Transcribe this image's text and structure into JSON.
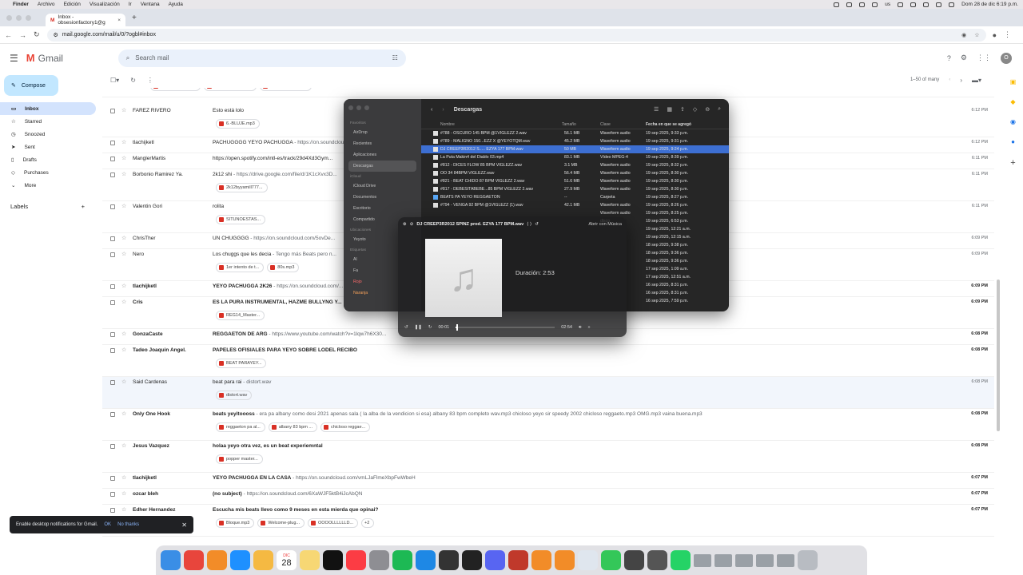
{
  "menubar": {
    "apple": "",
    "items": [
      "Finder",
      "Archivo",
      "Edición",
      "Visualización",
      "Ir",
      "Ventana",
      "Ayuda"
    ],
    "status": [
      "us"
    ],
    "clock": "Dom 28 de dic  6:19 p.m."
  },
  "browser": {
    "tab_title": "Inbox - obsesionfactory1@g",
    "url": "mail.google.com/mail/u/0/?ogbl#inbox"
  },
  "gmail": {
    "logo": "Gmail",
    "search_placeholder": "Search mail",
    "compose": "Compose",
    "nav": [
      {
        "icon": "inbox-icon",
        "label": "Inbox"
      },
      {
        "icon": "star-icon",
        "label": "Starred"
      },
      {
        "icon": "clock-icon",
        "label": "Snoozed"
      },
      {
        "icon": "send-icon",
        "label": "Sent"
      },
      {
        "icon": "file-icon",
        "label": "Drafts"
      },
      {
        "icon": "tag-icon",
        "label": "Purchases"
      },
      {
        "icon": "chevron-down-icon",
        "label": "More"
      }
    ],
    "labels_title": "Labels",
    "labels_add": "+",
    "pagination": "1–50 of many",
    "avatar": "O",
    "toast": {
      "text": "Enable desktop notifications for Gmail.",
      "ok": "OK",
      "no": "No thanks",
      "close": "✕"
    },
    "rows": [
      {
        "sender": "",
        "subject": "",
        "snippet": "",
        "date": "",
        "bold": false,
        "hl": false,
        "chips": [
          "BEAT SENSACI...",
          "BEAT TUKI S TO...",
          "BEAT FERRAGA..."
        ]
      },
      {
        "sender": "FAREZ RIVERO",
        "subject": "Esto está lolo",
        "snippet": "",
        "date": "6:12 PM",
        "bold": false,
        "hl": false,
        "chips": [
          "6.-BLUJE.mp3"
        ]
      },
      {
        "sender": "tlachijketl",
        "subject": "PACHUGGGG YEYO PACHUGGA",
        "snippet": " - https://on.soundcloud.com/...",
        "date": "6:12 PM",
        "bold": false,
        "hl": false,
        "chips": []
      },
      {
        "sender": "ManglerMartis",
        "subject": "https://open.spotify.com/intl-es/track/29d4Xd3Gym...",
        "snippet": "",
        "date": "6:11 PM",
        "bold": false,
        "hl": false,
        "chips": []
      },
      {
        "sender": "Borbonio Ramirez Ya.",
        "subject": "2k12 shi",
        "snippet": " - https://drive.google.com/file/d/1K1cXvx3D...",
        "date": "6:11 PM",
        "bold": false,
        "hl": false,
        "chips": [
          "2k12byyamill777..."
        ]
      },
      {
        "sender": "Valentin Gori",
        "subject": "rolita",
        "snippet": "",
        "date": "6:11 PM",
        "bold": false,
        "hl": false,
        "chips": [
          "SITUNOESTAS..."
        ]
      },
      {
        "sender": "ChrisTher",
        "subject": "UN CHUGGGG",
        "snippet": " - https://on.soundcloud.com/5ovDe...",
        "date": "6:09 PM",
        "bold": false,
        "hl": false,
        "chips": []
      },
      {
        "sender": "Nero",
        "subject": "Los chuggs que les decia",
        "snippet": " - Tengo más Beats pero n...",
        "date": "6:09 PM",
        "bold": false,
        "hl": false,
        "chips": [
          "1er intento de t...",
          "80s.mp3"
        ]
      },
      {
        "sender": "tlachijketl",
        "subject": "YEYO PACHUGGA 2K26",
        "snippet": " - https://on.soundcloud.com/...",
        "date": "6:09 PM",
        "bold": true,
        "hl": false,
        "chips": []
      },
      {
        "sender": "Cris",
        "subject": "ES LA PURA INSTRUMENTAL, HAZME BULLYNG Y...",
        "snippet": "",
        "date": "6:09 PM",
        "bold": true,
        "hl": false,
        "chips": [
          "REG14_Master..."
        ]
      },
      {
        "sender": "GonzaCaste",
        "subject": "REGGAETON DE ARG",
        "snippet": " - https://www.youtube.com/watch?v=1lqw7h6X30...",
        "date": "6:08 PM",
        "bold": true,
        "hl": false,
        "chips": []
      },
      {
        "sender": "Tadeo Joaquin Angel.",
        "subject": "PAPELES OFISIALES PARA YEYO SOBRE LODEL RECIBO",
        "snippet": "",
        "date": "6:08 PM",
        "bold": true,
        "hl": false,
        "chips": [
          "BEAT PARAYEY..."
        ]
      },
      {
        "sender": "Said Cardenas",
        "subject": "beat para rai",
        "snippet": " - distort.wav",
        "date": "6:08 PM",
        "bold": false,
        "hl": true,
        "chips": [
          "distort.wav"
        ]
      },
      {
        "sender": "Only One Hook",
        "subject": "beats yeyitoooss",
        "snippet": " - era pa albany como desi 2021 apenas sala ( la alba de la vendicion si esa) albany 83 bpm completo wav.mp3 chicloso yeyo sir speedy 2002 chicloso reggaeto.mp3 OMG.mp3 vaina buena.mp3",
        "date": "6:08 PM",
        "bold": true,
        "hl": false,
        "chips": [
          "reggaeton pa al...",
          "albany 83 bpm ...",
          "chicloso reggae..."
        ]
      },
      {
        "sender": "Jesus Vazquez",
        "subject": "holaa yeyo otra vez, es un beat experiemntal",
        "snippet": "",
        "date": "6:08 PM",
        "bold": true,
        "hl": false,
        "chips": [
          "popper master..."
        ]
      },
      {
        "sender": "tlachijketl",
        "subject": "YEYO PACHUGGA EN LA CASA",
        "snippet": " - https://on.soundcloud.com/vmLJaFlmeXbpFwWbeH",
        "date": "6:07 PM",
        "bold": true,
        "hl": false,
        "chips": []
      },
      {
        "sender": "ozcar bleh",
        "subject": "(no subject)",
        "snippet": " - https://on.soundcloud.com/6XaWJF5ktB4iJcAbQN",
        "date": "6:07 PM",
        "bold": true,
        "hl": false,
        "chips": []
      },
      {
        "sender": "Edher Hernandez",
        "subject": "Escucha mis beats llevo como 9 meses en esta mierda que opinai?",
        "snippet": "",
        "date": "6:07 PM",
        "bold": true,
        "hl": false,
        "chips": [
          "Bloque.mp3",
          "Welcome-plug...",
          "OOOOLLLLLLD...",
          "+2"
        ]
      }
    ]
  },
  "finder": {
    "title": "Descargas",
    "sidebar": {
      "sections": [
        {
          "name": "Favoritos",
          "items": [
            "AirDrop",
            "Recientes",
            "Aplicaciones",
            "Descargas"
          ]
        },
        {
          "name": "iCloud",
          "items": [
            "iCloud Drive",
            "Documentos",
            "Escritorio",
            "Compartido"
          ]
        },
        {
          "name": "Ubicaciones",
          "items": [
            "Yeyoto"
          ]
        },
        {
          "name": "Etiquetas",
          "items": [
            "Al",
            "Fa",
            "Rojo",
            "Naranja"
          ]
        }
      ],
      "selected": "Descargas"
    },
    "columns": [
      "Nombre",
      "Tamaño",
      "Clase",
      "Fecha en que se agregó"
    ],
    "rows": [
      {
        "name": "#788 - OSCURO 145 BPM @1VIGLEZZ 2.wav",
        "size": "56.1 MB",
        "kind": "Waveform audio",
        "date": "19 sep 2025, 9:33 p.m.",
        "sel": false,
        "folder": false
      },
      {
        "name": "#789 - MALIGNO 150...EZZ X @YEYOTQM.wav",
        "size": "45.2 MB",
        "kind": "Waveform audio",
        "date": "19 sep 2025, 9:31 p.m.",
        "sel": false,
        "folder": false
      },
      {
        "name": "DJ CREEP3R2012 S..... EZYA 177 BPM.wav",
        "size": "50 MB",
        "kind": "Waveform audio",
        "date": "19 sep 2025, 9:24 p.m.",
        "sel": true,
        "folder": false
      },
      {
        "name": "La Puta Makin4 del Diablo 03.mp4",
        "size": "83.1 MB",
        "kind": "Vídeo MPEG-4",
        "date": "19 sep 2025, 8:39 p.m.",
        "sel": false,
        "folder": false
      },
      {
        "name": "#812 - DICES FLOW 85 BPM VIGLEZZ.wav",
        "size": "3.1 MB",
        "kind": "Waveform audio",
        "date": "19 sep 2025, 8:32 p.m.",
        "sel": false,
        "folder": false
      },
      {
        "name": "OO 34 84BPM VIGLEZZ.wav",
        "size": "56.4 MB",
        "kind": "Waveform audio",
        "date": "19 sep 2025, 8:30 p.m.",
        "sel": false,
        "folder": false
      },
      {
        "name": "#821 - BEAT CHIDO 87 BPM VIGLEZZ 2.wav",
        "size": "51.6 MB",
        "kind": "Waveform audio",
        "date": "19 sep 2025, 8:30 p.m.",
        "sel": false,
        "folder": false
      },
      {
        "name": "#817 - DEBESITABEBE...85 BPM VIGLEZZ 2.wav",
        "size": "27.9 MB",
        "kind": "Waveform audio",
        "date": "19 sep 2025, 8:30 p.m.",
        "sel": false,
        "folder": false
      },
      {
        "name": "BEATS PA YEYO REGGAETON",
        "size": "--",
        "kind": "Carpeta",
        "date": "19 sep 2025, 8:27 p.m.",
        "sel": false,
        "folder": true
      },
      {
        "name": "#794 - VENGA 92 BPM @1VIGLEZZ (1).wav",
        "size": "42.1 MB",
        "kind": "Waveform audio",
        "date": "19 sep 2025, 8:26 p.m.",
        "sel": false,
        "folder": false
      },
      {
        "name": "",
        "size": "",
        "kind": "Waveform audio",
        "date": "19 sep 2025, 8:25 p.m.",
        "sel": false,
        "folder": false
      },
      {
        "name": "",
        "size": "",
        "kind": "disco",
        "date": "19 sep 2025, 6:53 p.m.",
        "sel": false,
        "folder": false
      },
      {
        "name": "",
        "size": "",
        "kind": "",
        "date": "19 sep 2025, 12:21 a.m.",
        "sel": false,
        "folder": false
      },
      {
        "name": "",
        "size": "",
        "kind": "",
        "date": "19 sep 2025, 12:15 a.m.",
        "sel": false,
        "folder": false
      },
      {
        "name": "",
        "size": "",
        "kind": "",
        "date": "18 sep 2025, 9:38 p.m.",
        "sel": false,
        "folder": false
      },
      {
        "name": "",
        "size": "",
        "kind": "",
        "date": "18 sep 2025, 9:36 p.m.",
        "sel": false,
        "folder": false
      },
      {
        "name": "",
        "size": "",
        "kind": "",
        "date": "18 sep 2025, 9:36 p.m.",
        "sel": false,
        "folder": false
      },
      {
        "name": "",
        "size": "",
        "kind": "",
        "date": "17 sep 2025, 1:09 a.m.",
        "sel": false,
        "folder": false
      },
      {
        "name": "",
        "size": "",
        "kind": "",
        "date": "17 sep 2025, 12:51 a.m.",
        "sel": false,
        "folder": false
      },
      {
        "name": "",
        "size": "",
        "kind": "",
        "date": "16 sep 2025, 8:31 p.m.",
        "sel": false,
        "folder": false
      },
      {
        "name": "",
        "size": "",
        "kind": "",
        "date": "16 sep 2025, 8:31 p.m.",
        "sel": false,
        "folder": false
      },
      {
        "name": "",
        "size": "",
        "kind": "",
        "date": "16 sep 2025, 7:59 p.m.",
        "sel": false,
        "folder": false
      }
    ]
  },
  "player": {
    "title": "DJ CREEP3R2012 SPINZ prod. EZYA 177 BPM.wav",
    "open_with": "Abrir con Música",
    "duration": "Duración: 2:53",
    "elapsed": "00:01",
    "total": "02:54",
    "progress": 0.006
  },
  "dock": {
    "icons": [
      "finder-icon",
      "chrome-icon",
      "fl-studio-icon",
      "app-store-icon",
      "photos-icon",
      "calendar-icon",
      "notes-icon",
      "apple-tv-icon",
      "music-icon",
      "settings-icon",
      "spotify-icon",
      "safari-icon",
      "logic-icon",
      "clock-icon",
      "discord-icon",
      "photo-booth-icon",
      "fl-studio-icon",
      "fl-studio-icon",
      "virtualbox-icon",
      "facetime-icon",
      "utility-icon",
      "pro-tools-icon",
      "whatsapp-icon",
      "window-icon",
      "window-icon",
      "window-icon",
      "window-icon",
      "window-icon",
      "trash-icon"
    ],
    "calendar_day": "28",
    "calendar_month": "DIC"
  }
}
